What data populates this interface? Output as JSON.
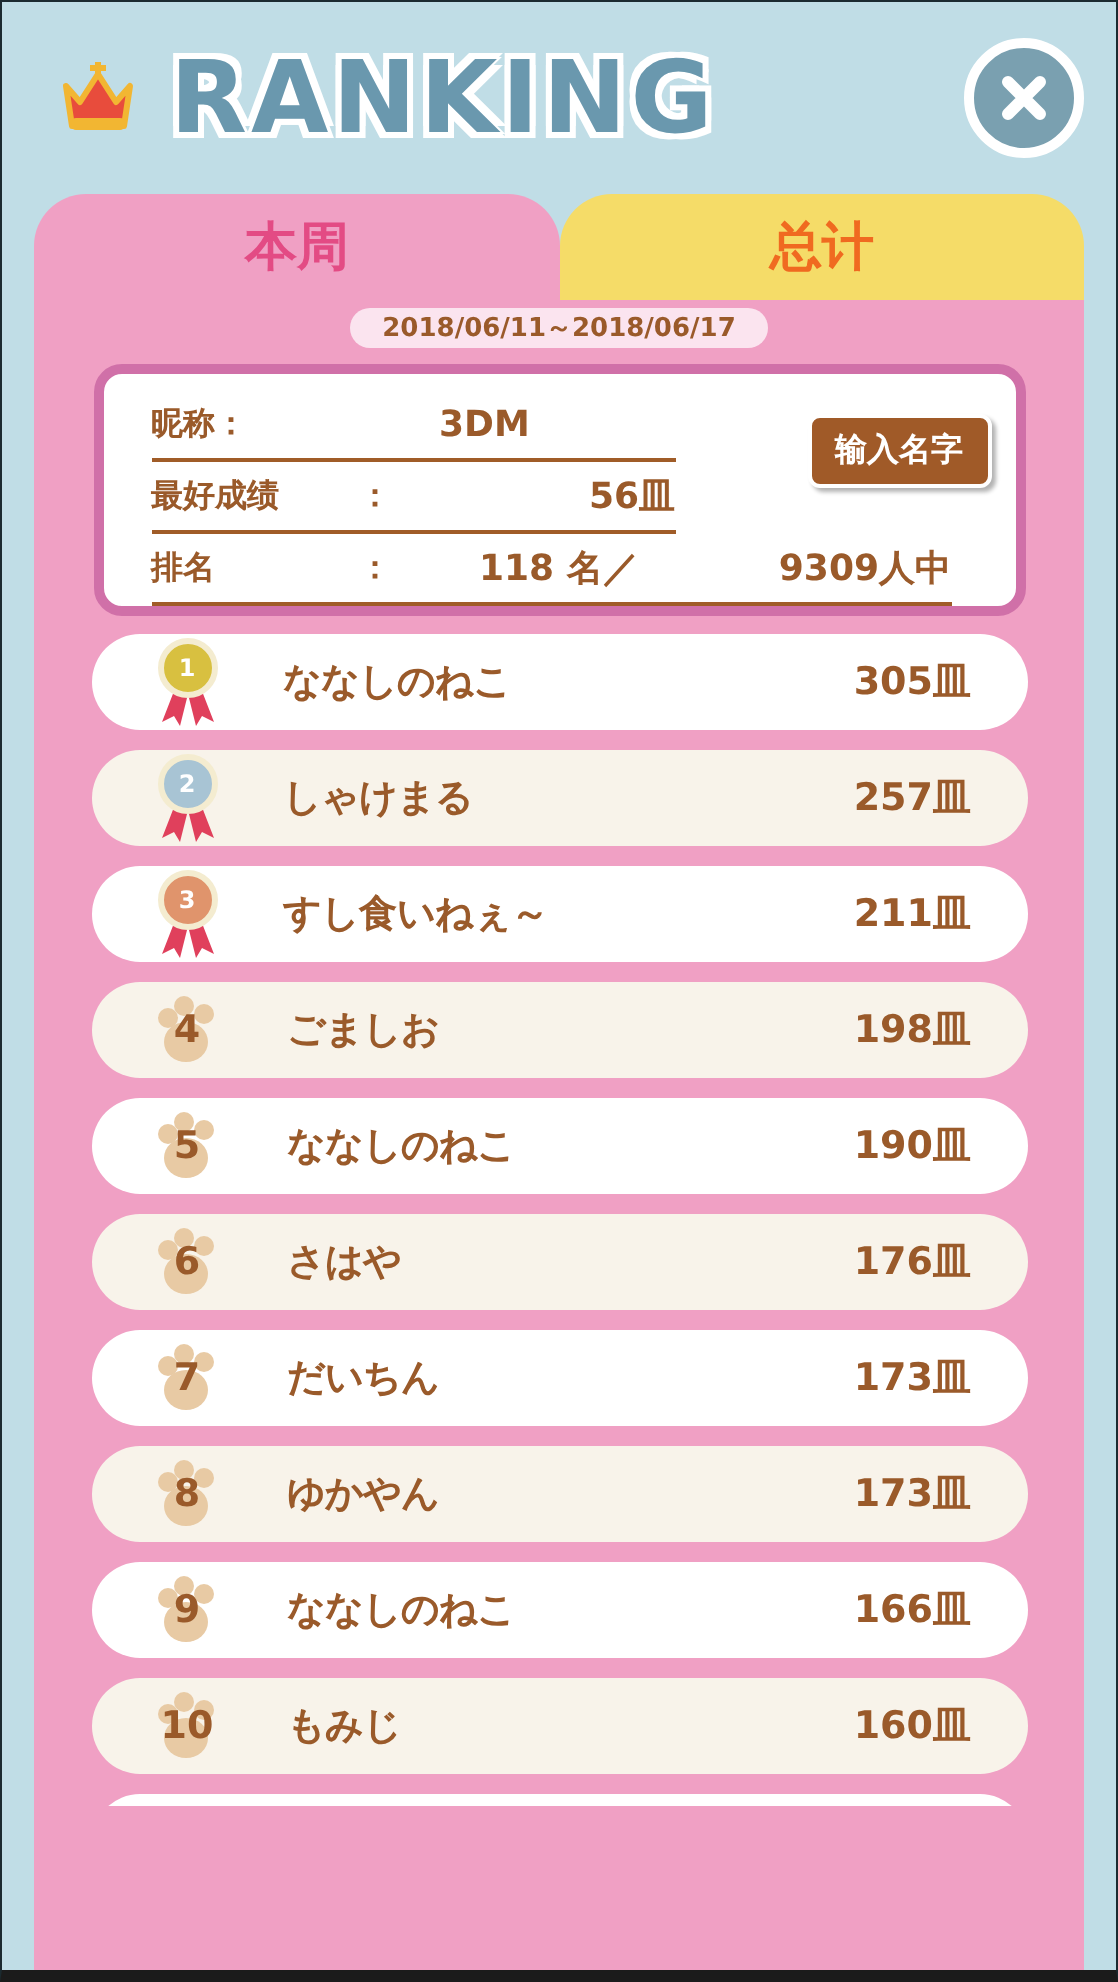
{
  "title": "RANKING",
  "tabs": [
    {
      "label": "本周",
      "selected": true
    },
    {
      "label": "总计",
      "selected": false
    }
  ],
  "date_range": "2018/06/11～2018/06/17",
  "profile": {
    "nickname_label": "昵称：",
    "nickname": "3DM",
    "best_label": "最好成绩",
    "best_colon": "：",
    "best_value": "56皿",
    "rank_label": "排名",
    "rank_colon": "：",
    "rank_value": "118 名／",
    "total_value": "9309人中",
    "button": "输入名字"
  },
  "rankings": [
    {
      "kind": "medal",
      "color": "#d8c040",
      "rank": "1",
      "name": "ななしのねこ",
      "score": "305皿"
    },
    {
      "kind": "medal",
      "color": "#a8c4d4",
      "rank": "2",
      "name": "しゃけまる",
      "score": "257皿"
    },
    {
      "kind": "medal",
      "color": "#e0946c",
      "rank": "3",
      "name": "すし食いねぇ～",
      "score": "211皿"
    },
    {
      "kind": "paw",
      "rank": "4",
      "name": "ごましお",
      "score": "198皿"
    },
    {
      "kind": "paw",
      "rank": "5",
      "name": "ななしのねこ",
      "score": "190皿"
    },
    {
      "kind": "paw",
      "rank": "6",
      "name": "さはや",
      "score": "176皿"
    },
    {
      "kind": "paw",
      "rank": "7",
      "name": "だいちん",
      "score": "173皿"
    },
    {
      "kind": "paw",
      "rank": "8",
      "name": "ゆかやん",
      "score": "173皿"
    },
    {
      "kind": "paw",
      "rank": "9",
      "name": "ななしのねこ",
      "score": "166皿"
    },
    {
      "kind": "paw",
      "rank": "10",
      "name": "もみじ",
      "score": "160皿"
    },
    {
      "kind": "blank"
    }
  ]
}
